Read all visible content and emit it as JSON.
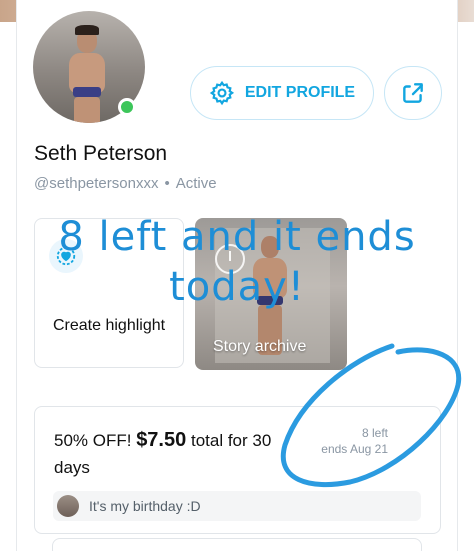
{
  "profile": {
    "name": "Seth Peterson",
    "handle": "@sethpetersonxxx",
    "status": "Active",
    "online": true
  },
  "actions": {
    "edit_profile_label": "EDIT PROFILE",
    "edit_icon": "gear-icon",
    "share_icon": "share-icon"
  },
  "highlights": {
    "create_label": "Create highlight",
    "create_icon": "heart-circle-icon",
    "archive_label": "Story archive",
    "archive_icon": "clock-icon"
  },
  "overlay": {
    "line1": "8 left and it ends",
    "line2": "today!"
  },
  "promotion": {
    "prefix": "50% OFF! ",
    "price": "$7.50",
    "suffix": " total for 30 days",
    "left": "8 left",
    "ends": "ends Aug 21",
    "message": "It's my birthday :D"
  },
  "colors": {
    "accent": "#12a6e0",
    "overlay_text": "#1e8ed6",
    "online": "#3cc65a",
    "muted": "#8a96a3"
  }
}
